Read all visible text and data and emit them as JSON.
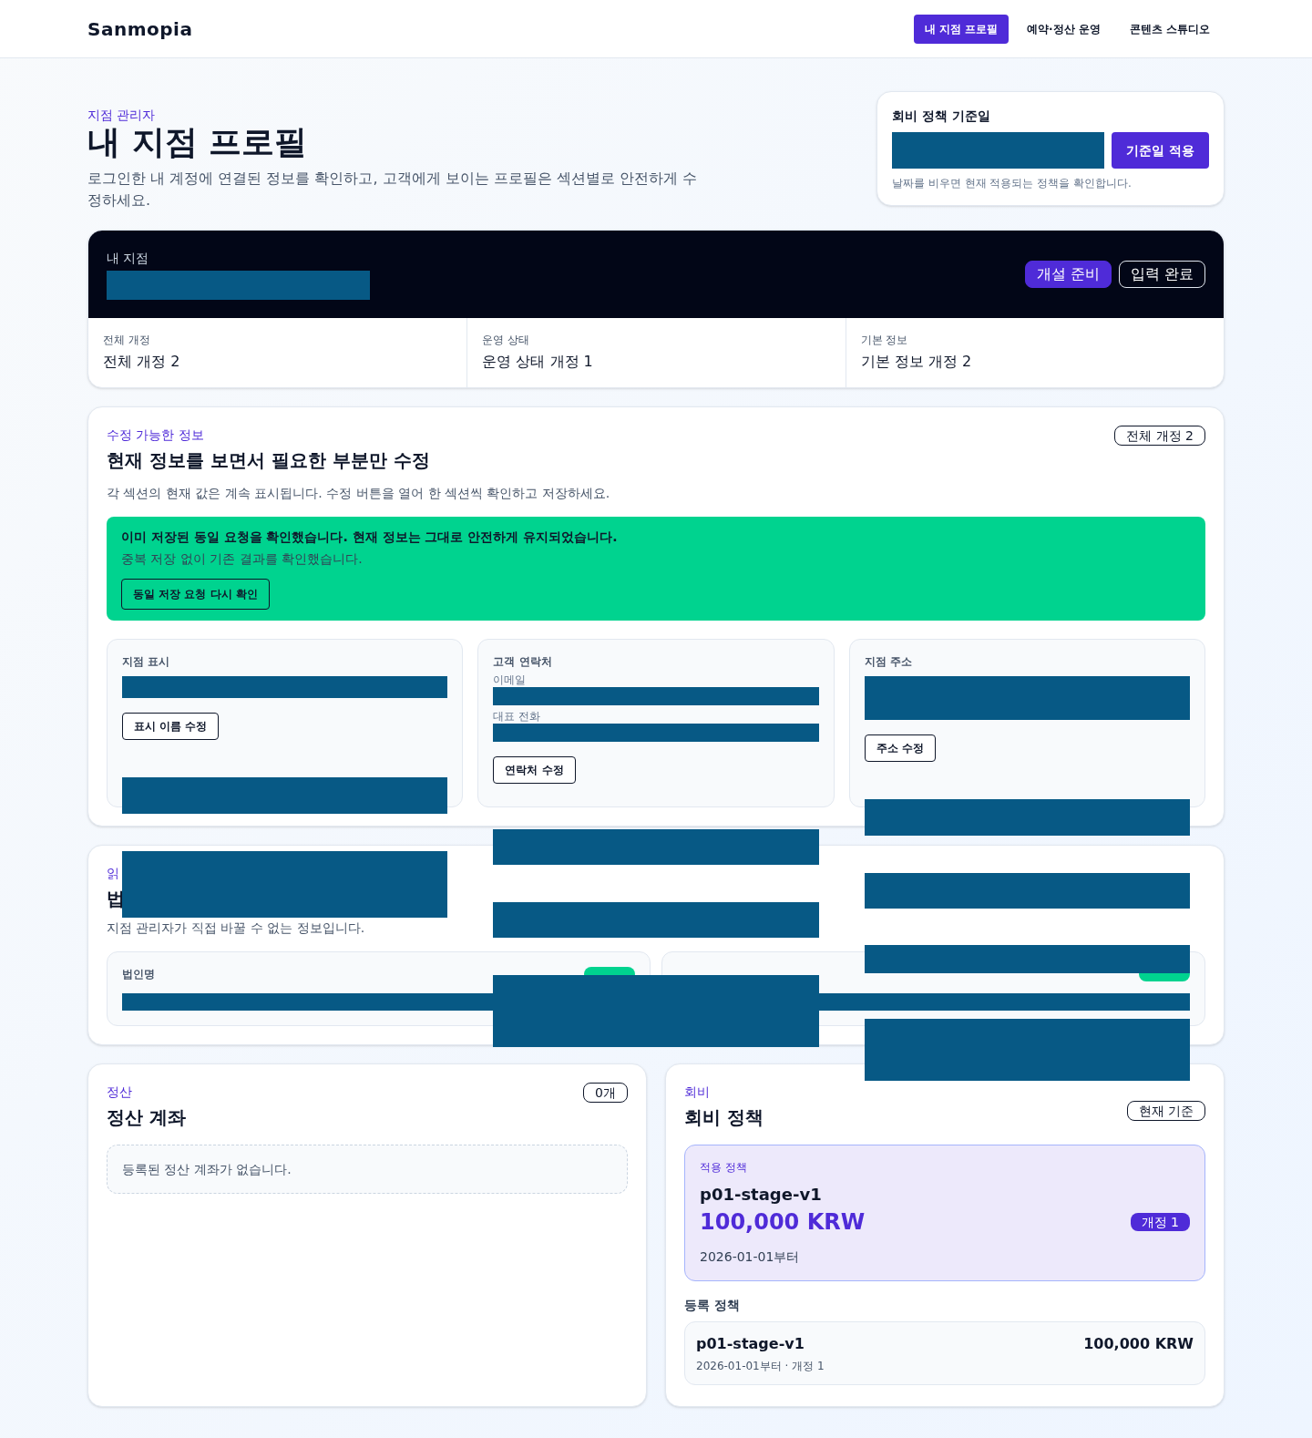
{
  "brand": "Sanmopia",
  "nav": [
    {
      "label": "내 지점 프로필",
      "selected": true
    },
    {
      "label": "예약·정산 운영",
      "selected": false
    },
    {
      "label": "콘텐츠 스튜디오",
      "selected": false
    }
  ],
  "hero": {
    "eyebrow": "지점 관리자",
    "title": "내 지점 프로필",
    "description": "로그인한 내 계정에 연결된 정보를 확인하고, 고객에게 보이는 프로필은 섹션별로 안전하게 수정하세요."
  },
  "policy_date": {
    "label": "회비 정책 기준일",
    "button": "기준일 적용",
    "hint": "날짜를 비우면 현재 적용되는 정책을 확인합니다."
  },
  "branch": {
    "label": "내 지점",
    "badges": [
      {
        "label": "개설 준비",
        "kind": "solid"
      },
      {
        "label": "입력 완료",
        "kind": "outline"
      }
    ],
    "stats": [
      {
        "label": "전체 개정",
        "value": "전체 개정 2"
      },
      {
        "label": "운영 상태",
        "value": "운영 상태 개정 1"
      },
      {
        "label": "기본 정보",
        "value": "기본 정보 개정 2"
      }
    ]
  },
  "editable": {
    "eyebrow": "수정 가능한 정보",
    "title": "현재 정보를 보면서 필요한 부분만 수정",
    "badge": "전체 개정 2",
    "description": "각 섹션의 현재 값은 계속 표시됩니다. 수정 버튼을 열어 한 섹션씩 확인하고 저장하세요.",
    "notice": {
      "title": "이미 저장된 동일 요청을 확인했습니다. 현재 정보는 그대로 안전하게 유지되었습니다.",
      "body": "중복 저장 없이 기존 결과를 확인했습니다.",
      "button": "동일 저장 요청 다시 확인"
    },
    "sections": [
      {
        "title": "지점 표시",
        "kind": "single",
        "button": "표시 이름 수정"
      },
      {
        "title": "고객 연락처",
        "kind": "fields",
        "fields": [
          "이메일",
          "대표 전화"
        ],
        "button": "연락처 수정"
      },
      {
        "title": "지점 주소",
        "kind": "tall",
        "button": "주소 수정"
      }
    ]
  },
  "readonly": {
    "eyebrow": "읽",
    "title": "법",
    "description": "지점 관리자가 직접 바꿀 수 없는 정보입니다.",
    "cards": [
      {
        "label": "법인명",
        "kind": "badge"
      },
      {
        "kind": "badge"
      }
    ]
  },
  "settlement": {
    "eyebrow": "정산",
    "title": "정산 계좌",
    "badge": "0개",
    "empty": "등록된 정산 계좌가 없습니다."
  },
  "fee": {
    "eyebrow": "회비",
    "title": "회비 정책",
    "badge": "현재 기준",
    "active": {
      "label": "적용 정책",
      "name": "p01-stage-v1",
      "amount": "100,000 KRW",
      "revision": "개정 1",
      "since": "2026-01-01부터"
    },
    "registered_label": "등록 정책",
    "registered": [
      {
        "name": "p01-stage-v1",
        "amount": "100,000 KRW",
        "meta": "2026-01-01부터 · 개정 1"
      }
    ]
  }
}
